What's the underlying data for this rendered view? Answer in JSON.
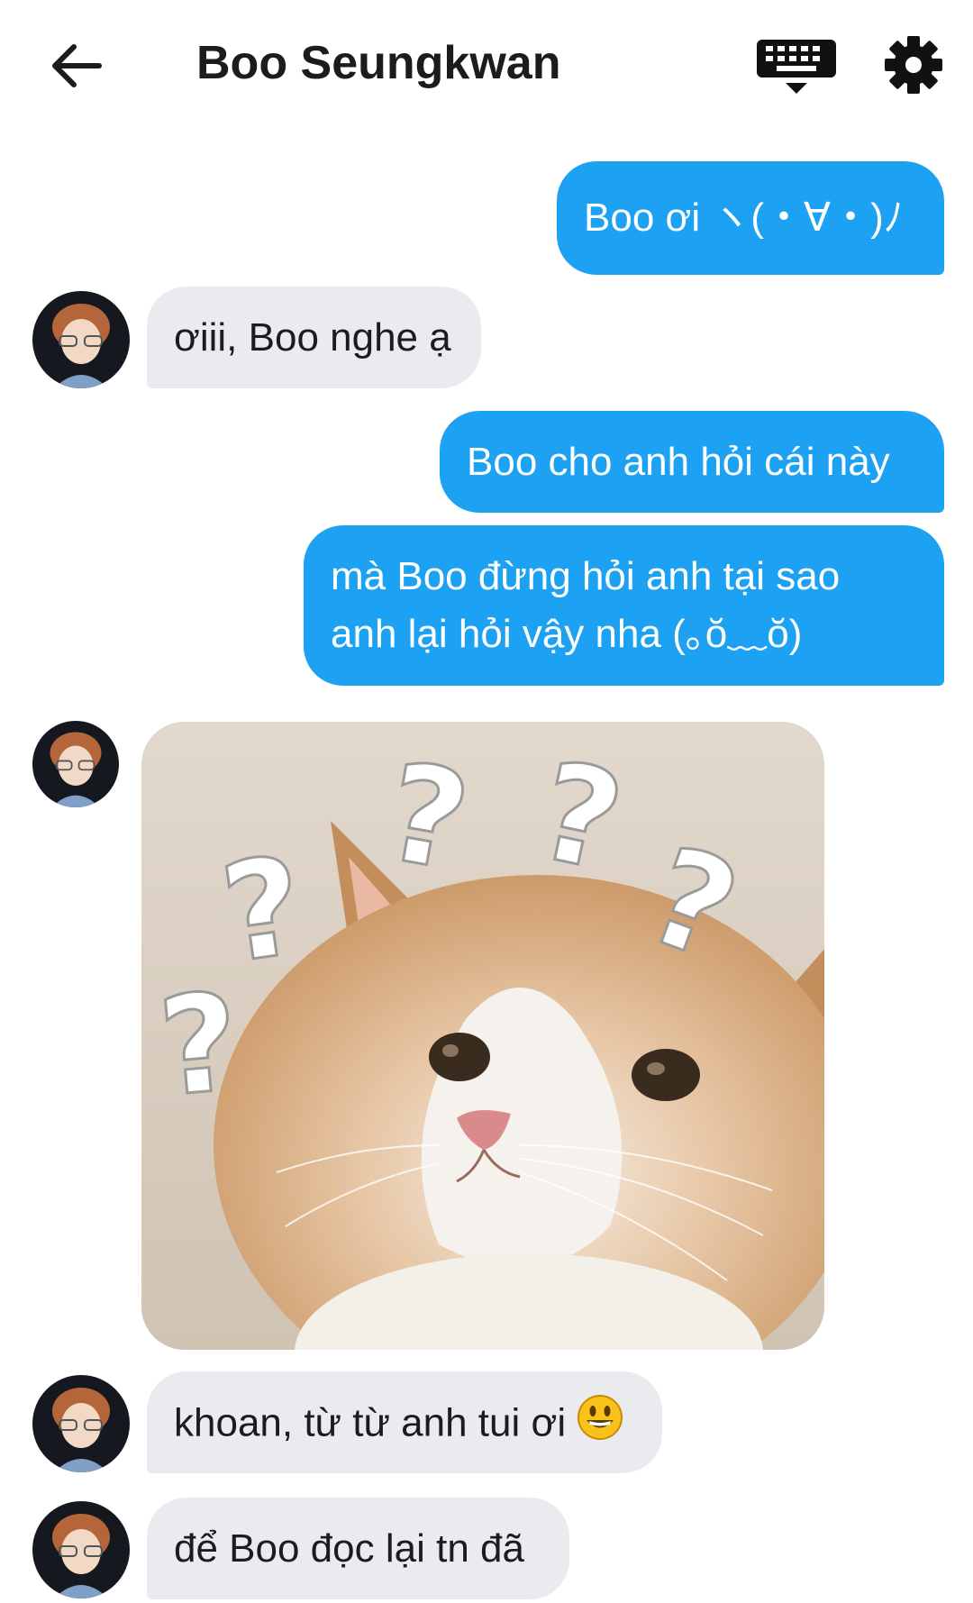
{
  "header": {
    "title": "Boo Seungkwan",
    "back_icon": "back-arrow-icon",
    "keyboard_icon": "keyboard-icon",
    "settings_icon": "gear-icon"
  },
  "colors": {
    "outgoing_bubble": "#1da1f2",
    "incoming_bubble": "#e9ebee",
    "text_dark": "#1c1c1e"
  },
  "messages": [
    {
      "side": "out",
      "text": "Boo ơi ヽ(・∀・)ﾉ"
    },
    {
      "side": "in",
      "text": "ơiii, Boo nghe ạ"
    },
    {
      "side": "out",
      "text": "Boo cho anh hỏi cái này"
    },
    {
      "side": "out",
      "line1": "mà Boo đừng hỏi anh tại sao",
      "line2": "anh lại hỏi vậy nha (｡ŏ﹏ŏ)"
    },
    {
      "side": "in",
      "type": "image",
      "image": "confused-cat-question-marks"
    },
    {
      "side": "in",
      "text": "khoan, từ từ anh tui ơi",
      "emoji": "grinning-face-emoji"
    },
    {
      "side": "in",
      "text": "để Boo đọc lại tn đã"
    }
  ]
}
